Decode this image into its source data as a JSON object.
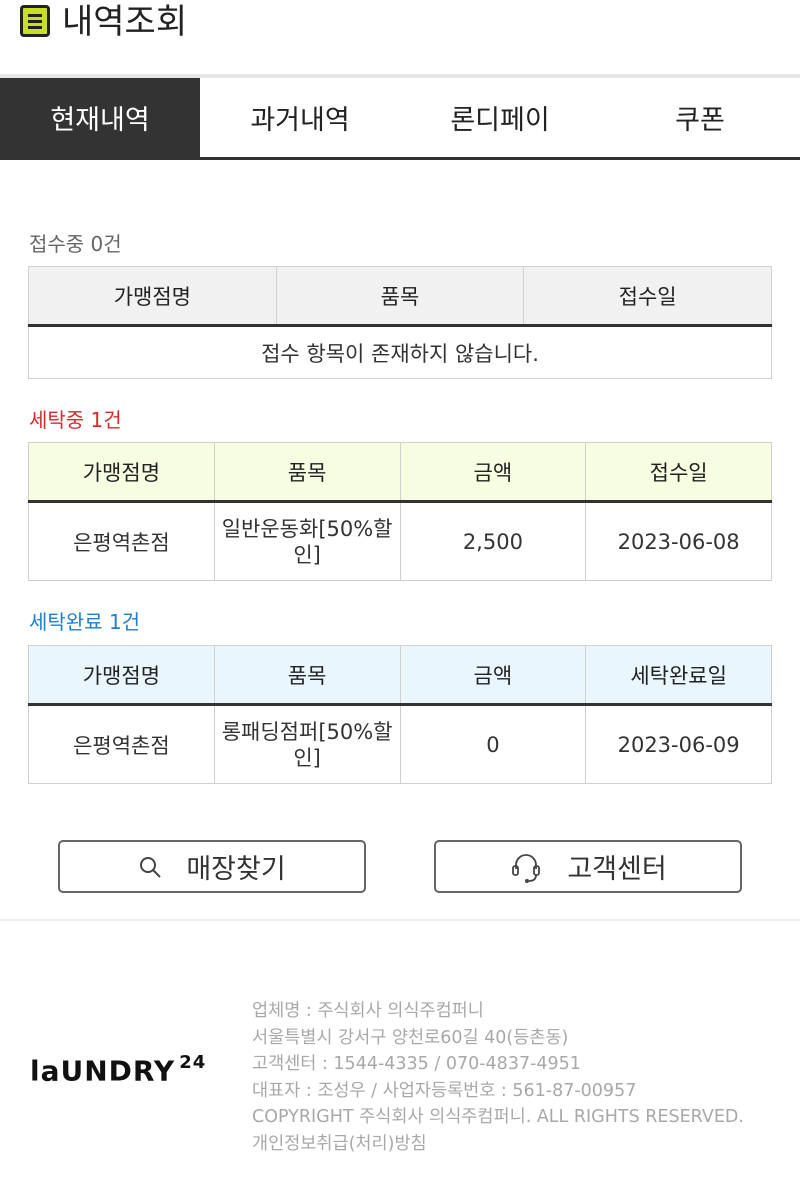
{
  "header": {
    "title": "내역조회",
    "icon": "document-list-icon"
  },
  "tabs": [
    {
      "label": "현재내역",
      "active": true
    },
    {
      "label": "과거내역",
      "active": false
    },
    {
      "label": "론디페이",
      "active": false
    },
    {
      "label": "쿠폰",
      "active": false
    }
  ],
  "receipt": {
    "label": "접수중 0건",
    "headers": [
      "가맹점명",
      "품목",
      "접수일"
    ],
    "empty_message": "접수 항목이 존재하지 않습니다."
  },
  "washing": {
    "label": "세탁중 1건",
    "headers": [
      "가맹점명",
      "품목",
      "금액",
      "접수일"
    ],
    "rows": [
      {
        "store": "은평역촌점",
        "item": "일반운동화[50%할인]",
        "amount": "2,500",
        "date": "2023-06-08"
      }
    ]
  },
  "done": {
    "label": "세탁완료 1건",
    "headers": [
      "가맹점명",
      "품목",
      "금액",
      "세탁완료일"
    ],
    "rows": [
      {
        "store": "은평역촌점",
        "item": "롱패딩점퍼[50%할인]",
        "amount": "0",
        "date": "2023-06-09"
      }
    ]
  },
  "buttons": {
    "store_finder": {
      "label": "매장찾기",
      "icon": "search-icon"
    },
    "customer_center": {
      "label": "고객센터",
      "icon": "headset-icon"
    }
  },
  "footer": {
    "logo": "laUNDRY",
    "logo_sup": "24",
    "lines": [
      "업체명 : 주식회사 의식주컴퍼니",
      "서울특별시 강서구 양천로60길 40(등촌동)",
      "고객센터 : 1544-4335 / 070-4837-4951",
      "대표자 : 조성우 / 사업자등록번호 : 561-87-00957",
      "COPYRIGHT 주식회사 의식주컴퍼니. ALL RIGHTS RESERVED.",
      "개인정보취급(처리)방침"
    ]
  },
  "colors": {
    "tab_active_bg": "#333333",
    "washing_label": "#d62b2b",
    "done_label": "#1e7fd1",
    "washing_header_bg": "#f7fde0",
    "done_header_bg": "#eaf6fd"
  }
}
